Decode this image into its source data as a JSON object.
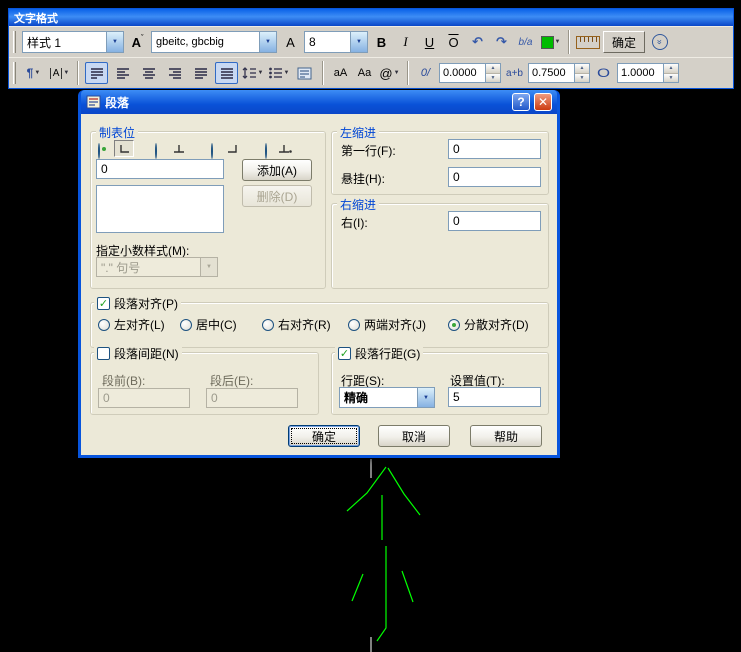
{
  "glyphs": {
    "dropdown": "▼",
    "spin_up": "▲",
    "spin_down": "▼",
    "check": "✓"
  },
  "window": {
    "title": "文字格式"
  },
  "toolbar": {
    "style_value": "样式 1",
    "font_icon_glyph": "A",
    "font_value": "gbeitc, gbcbig",
    "height_icon_glyph": "A",
    "size_value": "8",
    "bold_glyph": "B",
    "italic_glyph": "I",
    "underline_glyph": "U",
    "overline_glyph": "O",
    "undo_glyph": "↶",
    "redo_glyph": "↷",
    "fraction_glyph": "b/a",
    "text_color": "#00bb00",
    "ok_label": "确定",
    "options_glyph": "»",
    "columns_glyph": "A",
    "paragraph_mark_glyph": "¶",
    "upper_glyph": "aA",
    "lower_glyph": "Aa",
    "at_glyph": "@",
    "oblique_glyph": "0/",
    "oblique_value": "0.0000",
    "tracking_glyph": "a+b",
    "tracking_value": "0.7500",
    "width_glyph": "O",
    "width_value": "1.0000"
  },
  "dialog": {
    "title": "段落",
    "help_glyph": "?",
    "close_glyph": "✕",
    "tabs": {
      "label": "制表位",
      "position_value": "0",
      "add_label": "添加(A)",
      "delete_label": "删除(D)",
      "decimal_label": "指定小数样式(M):",
      "decimal_value": "\".\" 句号"
    },
    "left_indent": {
      "label": "左缩进",
      "first_line_label": "第一行(F):",
      "first_line_value": "0",
      "hanging_label": "悬挂(H):",
      "hanging_value": "0"
    },
    "right_indent": {
      "label": "右缩进",
      "right_label": "右(I):",
      "right_value": "0"
    },
    "alignment": {
      "label": "段落对齐(P)",
      "checked": true,
      "options": [
        "左对齐(L)",
        "居中(C)",
        "右对齐(R)",
        "两端对齐(J)",
        "分散对齐(D)"
      ],
      "selected": "分散对齐(D)"
    },
    "spacing": {
      "label": "段落间距(N)",
      "checked": false,
      "before_label": "段前(B):",
      "before_value": "0",
      "after_label": "段后(E):",
      "after_value": "0"
    },
    "line_spacing": {
      "label": "段落行距(G)",
      "checked": true,
      "spacing_label": "行距(S):",
      "spacing_value": "精确",
      "set_label": "设置值(T):",
      "set_value": "5"
    },
    "buttons": {
      "ok": "确定",
      "cancel": "取消",
      "help": "帮助"
    }
  },
  "drawing": {
    "stroke_color": "#00ff00",
    "guide_color": "#ffffff"
  }
}
